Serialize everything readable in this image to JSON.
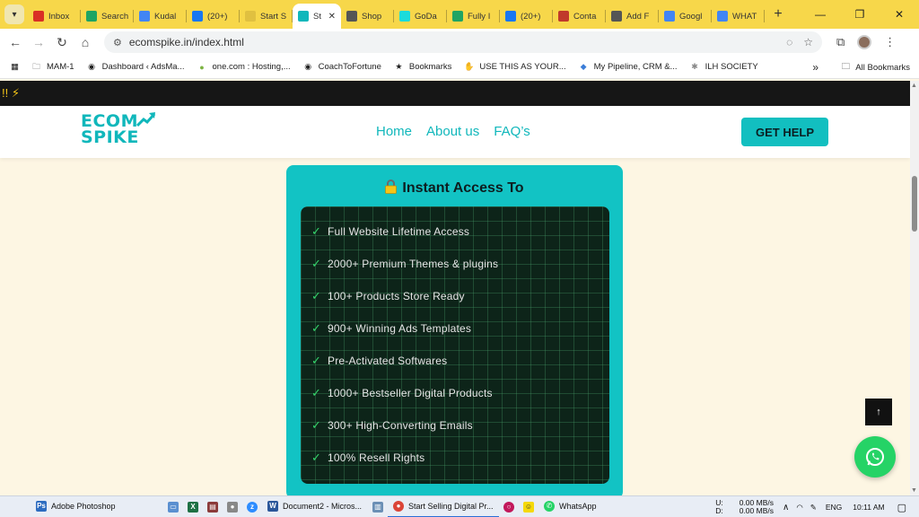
{
  "browser": {
    "tabs": [
      {
        "label": "Inbox",
        "icon": "gmail-icon",
        "color": "#d93025"
      },
      {
        "label": "Search",
        "icon": "drive-icon",
        "color": "#1fa463"
      },
      {
        "label": "Kudal",
        "icon": "docs-icon",
        "color": "#4285f4"
      },
      {
        "label": "(20+)",
        "icon": "facebook-icon",
        "color": "#1877f2"
      },
      {
        "label": "Start S",
        "icon": "site-icon",
        "color": "#e0c040"
      },
      {
        "label": "St",
        "icon": "ecomspike-icon",
        "color": "#10b7bb",
        "active": true
      },
      {
        "label": "Shop",
        "icon": "globe-icon",
        "color": "#555555"
      },
      {
        "label": "GoDa",
        "icon": "godaddy-icon",
        "color": "#1bdbdb"
      },
      {
        "label": "Fully I",
        "icon": "drive-icon",
        "color": "#1fa463"
      },
      {
        "label": "(20+)",
        "icon": "facebook-icon",
        "color": "#1877f2"
      },
      {
        "label": "Conta",
        "icon": "contact-icon",
        "color": "#c0392b"
      },
      {
        "label": "Add F",
        "icon": "globe-icon",
        "color": "#555555"
      },
      {
        "label": "Googl",
        "icon": "translate-icon",
        "color": "#4285f4"
      },
      {
        "label": "WHAT",
        "icon": "google-icon",
        "color": "#4285f4"
      }
    ],
    "url": "ecomspike.in/index.html",
    "bookmarks": [
      {
        "label": "MAM-1",
        "icon": "folder-icon"
      },
      {
        "label": "Dashboard ‹ AdsMa...",
        "icon": "wordpress-icon"
      },
      {
        "label": "one.com : Hosting,...",
        "icon": "onecom-icon"
      },
      {
        "label": "CoachToFortune",
        "icon": "wordpress-icon"
      },
      {
        "label": "Bookmarks",
        "icon": "star-icon"
      },
      {
        "label": "USE THIS AS YOUR...",
        "icon": "hand-icon"
      },
      {
        "label": "My Pipeline, CRM &...",
        "icon": "pipeline-icon"
      },
      {
        "label": "ILH SOCIETY",
        "icon": "ilh-icon"
      }
    ],
    "all_bookmarks": "All Bookmarks"
  },
  "site": {
    "topbar_text": "!! ⚡",
    "logo_line1": "ECOM",
    "logo_line2": "SPIKE",
    "nav": [
      "Home",
      "About us",
      "FAQ’s"
    ],
    "help_button": "GET HELP",
    "brand_color": "#10b7bb",
    "card": {
      "title": "Instant Access To",
      "features": [
        "Full Website Lifetime Access",
        "2000+ Premium Themes & plugins",
        "100+ Products Store Ready",
        "900+ Winning Ads Templates",
        "Pre-Activated Softwares",
        "1000+ Bestseller Digital Products",
        "300+ High-Converting Emails",
        "100% Resell Rights"
      ]
    }
  },
  "taskbar": {
    "apps": [
      {
        "label": "Adobe Photoshop",
        "icon": "photoshop-icon",
        "color": "#2d6cc0"
      },
      {
        "label": "Document2 - Micros...",
        "icon": "word-icon",
        "color": "#2b579a"
      },
      {
        "label": "Start Selling Digital Pr...",
        "icon": "chrome-icon",
        "color": "#db4437"
      },
      {
        "label": "WhatsApp",
        "icon": "whatsapp-icon",
        "color": "#25d366"
      }
    ],
    "net_up_label": "U:",
    "net_down_label": "D:",
    "net_up": "0.00 MB/s",
    "net_down": "0.00 MB/s",
    "language": "ENG",
    "time": "10:11 AM"
  }
}
